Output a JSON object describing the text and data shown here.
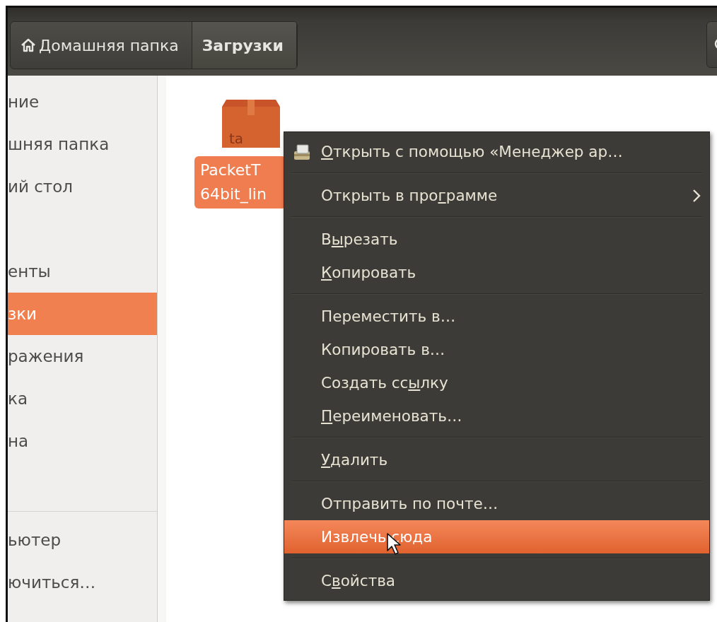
{
  "breadcrumb": [
    {
      "kind": "home",
      "label": "Домашняя папка",
      "selected": false
    },
    {
      "kind": "folder",
      "label": "Загрузки",
      "selected": true
    }
  ],
  "sidebar": {
    "groups": [
      {
        "items": [
          {
            "kind": "place",
            "label": "ние",
            "selected": false
          },
          {
            "kind": "place",
            "label": "шняя папка",
            "selected": false
          },
          {
            "kind": "place",
            "label": "ий стол",
            "selected": false
          },
          {
            "kind": "blank"
          },
          {
            "kind": "place",
            "label": "енты",
            "selected": false
          },
          {
            "kind": "place",
            "label": "зки",
            "selected": true
          },
          {
            "kind": "place",
            "label": "ражения",
            "selected": false
          },
          {
            "kind": "place",
            "label": "ка",
            "selected": false
          },
          {
            "kind": "place",
            "label": "на",
            "selected": false
          }
        ]
      },
      {
        "items": [
          {
            "kind": "place",
            "label": "ьютер",
            "selected": false
          },
          {
            "kind": "place",
            "label": "ючиться…",
            "selected": false
          }
        ]
      }
    ]
  },
  "files": [
    {
      "icon_text": "ta",
      "name_lines": [
        "PacketT",
        "64bit_lin"
      ],
      "selected": true
    }
  ],
  "context_menu": [
    {
      "kind": "app",
      "key": "О",
      "post": "ткрыть с помощью «Менеджер ар…",
      "selected": false
    },
    {
      "kind": "separator"
    },
    {
      "kind": "item",
      "pre": "Открыть в про",
      "key": "г",
      "post": "рамме",
      "submenu": true,
      "selected": false
    },
    {
      "kind": "separator"
    },
    {
      "kind": "item",
      "pre": "В",
      "key": "ы",
      "post": "резать",
      "selected": false
    },
    {
      "kind": "item",
      "key": "К",
      "post": "опировать",
      "selected": false
    },
    {
      "kind": "separator"
    },
    {
      "kind": "item",
      "pre": "Переместить в…",
      "selected": false
    },
    {
      "kind": "item",
      "pre": "Копировать в…",
      "selected": false
    },
    {
      "kind": "item",
      "pre": "Создать сс",
      "key": "ы",
      "post": "лку",
      "selected": false
    },
    {
      "kind": "item",
      "key": "П",
      "post": "ереименовать…",
      "selected": false
    },
    {
      "kind": "separator"
    },
    {
      "kind": "item",
      "key": "У",
      "post": "далить",
      "selected": false
    },
    {
      "kind": "separator"
    },
    {
      "kind": "item",
      "pre": "Отправить по почте…",
      "selected": false
    },
    {
      "kind": "item",
      "pre": "Извлечь сюда",
      "selected": true
    },
    {
      "kind": "separator"
    },
    {
      "kind": "item",
      "pre": "С",
      "key": "в",
      "post": "ойства",
      "selected": false
    }
  ]
}
